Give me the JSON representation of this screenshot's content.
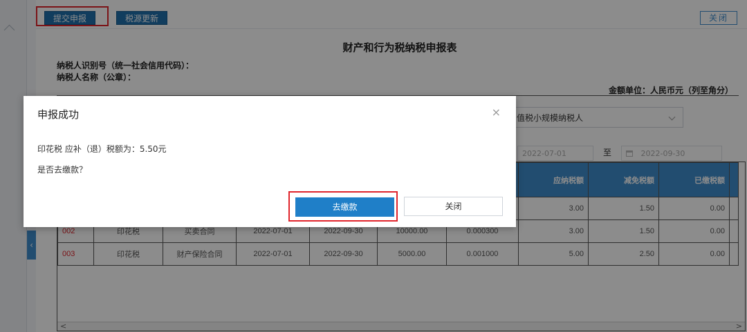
{
  "toolbar": {
    "submit_label": "提交申报",
    "tax_source_update_label": "税源更新",
    "close_label": "关闭"
  },
  "report": {
    "title": "财产和行为税纳税申报表",
    "taxpayer_id_label": "纳税人识别号（统一社会信用代码）：",
    "taxpayer_name_label": "纳税人名称（公章）：",
    "currency_unit": "金额单位：人民币元（列至角分）",
    "taxpayer_type_value": "值税小规模纳税人",
    "period_from": "2022-07-01",
    "period_sep": "至",
    "period_to": "2022-09-30"
  },
  "grid": {
    "headers": [
      "应纳税额",
      "减免税额",
      "已缴税额"
    ],
    "rows": [
      {
        "no": "",
        "tax": "",
        "item": "",
        "start": "",
        "end": "",
        "base": "",
        "rate": "",
        "payable": "3.00",
        "relief": "1.50",
        "paid": "0.00"
      },
      {
        "no": "002",
        "tax": "印花税",
        "item": "买卖合同",
        "start": "2022-07-01",
        "end": "2022-09-30",
        "base": "10000.00",
        "rate": "0.000300",
        "payable": "3.00",
        "relief": "1.50",
        "paid": "0.00"
      },
      {
        "no": "003",
        "tax": "印花税",
        "item": "财产保险合同",
        "start": "2022-07-01",
        "end": "2022-09-30",
        "base": "5000.00",
        "rate": "0.001000",
        "payable": "5.00",
        "relief": "2.50",
        "paid": "0.00"
      }
    ]
  },
  "modal": {
    "title": "申报成功",
    "message": "印花税 应补（退）税额为：5.50元",
    "question": "是否去缴款？",
    "pay_label": "去缴款",
    "close_label": "关闭"
  },
  "colors": {
    "primary": "#1f7fc8",
    "header_blue": "#3e8ccd",
    "highlight_red": "#e0242b"
  }
}
